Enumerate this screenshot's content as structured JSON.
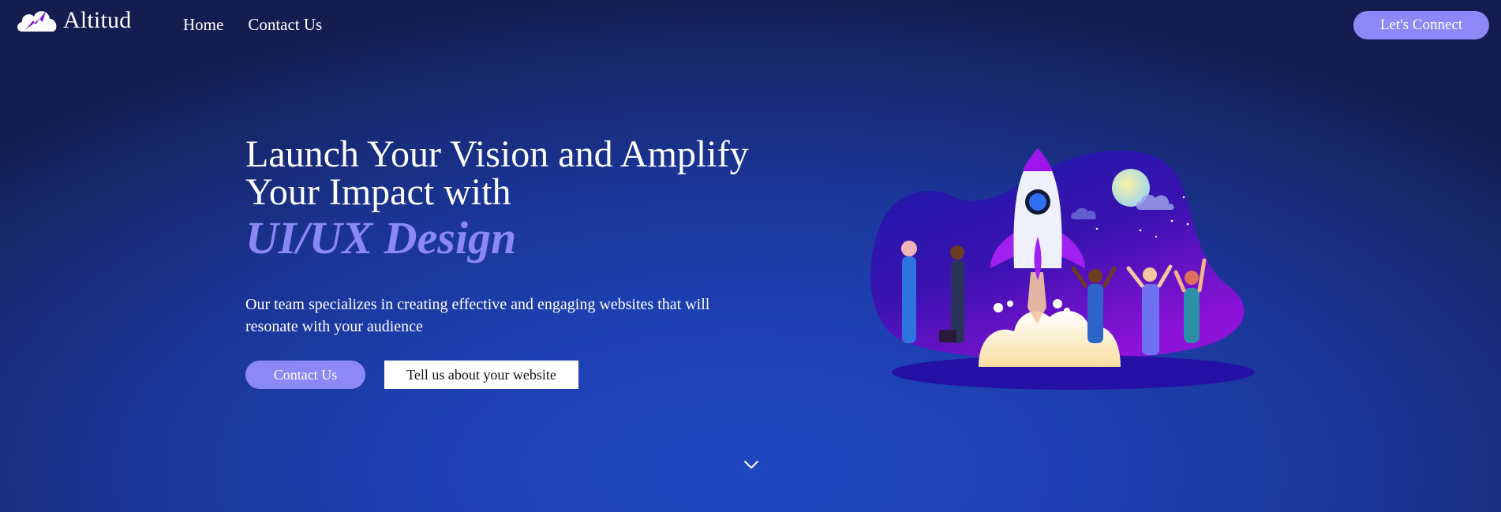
{
  "brand": {
    "name": "Altitud",
    "icon": "cloud-lightning-logo"
  },
  "nav": {
    "items": [
      {
        "label": "Home"
      },
      {
        "label": "Contact Us"
      }
    ]
  },
  "header": {
    "cta_label": "Let's Connect"
  },
  "hero": {
    "title_line1": "Launch Your Vision and Amplify",
    "title_line2": "Your Impact with",
    "title_accent": "UI/UX Design",
    "description": "Our team specializes in creating effective and engaging websites that will resonate with your audience",
    "primary_button": "Contact Us",
    "secondary_button": "Tell us about your website"
  },
  "icons": {
    "scroll": "chevron-down-icon",
    "illustration": "rocket-launch-team-illustration"
  },
  "colors": {
    "accent": "#8d88f7",
    "background_center": "#1f47c2",
    "background_edge": "#141d4f"
  }
}
